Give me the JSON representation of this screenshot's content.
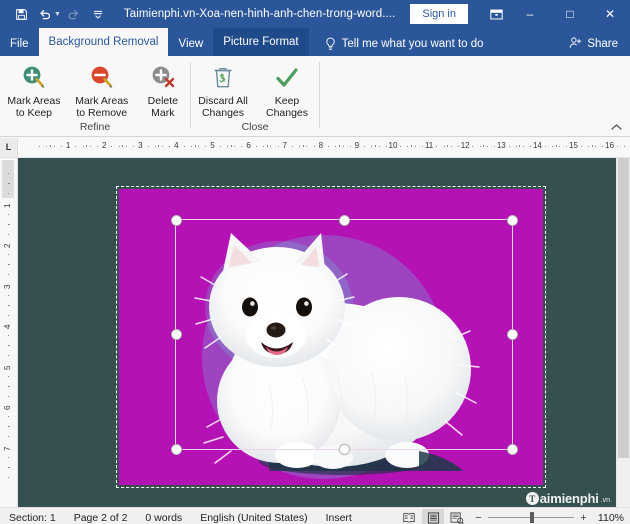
{
  "titlebar": {
    "quick_access": [
      {
        "name": "save-icon",
        "label": "Save"
      },
      {
        "name": "undo-icon",
        "label": "Undo"
      },
      {
        "name": "redo-icon",
        "label": "Redo"
      },
      {
        "name": "customize-qat-icon",
        "label": "Customize Quick Access Toolbar"
      }
    ],
    "document_title": "Taimienphi.vn-Xoa-nen-hinh-anh-chen-trong-word....",
    "sign_in": "Sign in",
    "ribbon_display_options": "Ribbon Display Options",
    "minimize": "–",
    "maximize": "□",
    "close": "✕",
    "bg_color": "#2b579a"
  },
  "tabs": [
    {
      "label": "File",
      "state": "normal"
    },
    {
      "label": "Background Removal",
      "state": "active"
    },
    {
      "label": "View",
      "state": "normal"
    },
    {
      "label": "Picture Format",
      "state": "contextual"
    }
  ],
  "tellme": {
    "icon": "lightbulb-icon",
    "label": "Tell me what you want to do"
  },
  "share": {
    "icon": "share-person-icon",
    "label": "Share"
  },
  "ribbon": {
    "collapse_icon": "chevron-up-icon",
    "groups": [
      {
        "label": "Refine",
        "buttons": [
          {
            "label_line1": "Mark Areas",
            "label_line2": "to Keep",
            "icon": "mark-areas-to-keep-icon",
            "color": "#3a8a74"
          },
          {
            "label_line1": "Mark Areas",
            "label_line2": "to Remove",
            "icon": "mark-areas-to-remove-icon",
            "color": "#d9482b"
          },
          {
            "label_line1": "Delete",
            "label_line2": "Mark",
            "icon": "delete-mark-icon",
            "color": "#8c8c8c"
          }
        ]
      },
      {
        "label": "Close",
        "buttons": [
          {
            "label_line1": "Discard All",
            "label_line2": "Changes",
            "icon": "trash-icon",
            "color": "#6e8d9c"
          },
          {
            "label_line1": "Keep",
            "label_line2": "Changes",
            "icon": "checkmark-icon",
            "color": "#4a9f5e"
          }
        ]
      }
    ]
  },
  "ruler": {
    "tab_selector": "L",
    "horizontal_numbers": [
      1,
      2,
      3,
      4,
      5,
      6,
      7,
      8,
      9,
      10,
      11,
      12,
      13,
      14,
      15,
      16
    ],
    "vertical_numbers": [
      1,
      2,
      3,
      4,
      5,
      6,
      7
    ]
  },
  "canvas": {
    "background_color": "#36504f",
    "removal_overlay_color": "#b512b5",
    "image_alt": "white pomeranian puppy photo with background removal magenta overlay",
    "selection_handles": 8,
    "watermark": {
      "badge": "T",
      "main": "aimienphi",
      "sub": ".vn"
    }
  },
  "statusbar": {
    "section": "Section: 1",
    "page": "Page 2 of 2",
    "words": "0 words",
    "language": "English (United States)",
    "mode": "Insert",
    "views": [
      {
        "name": "read-mode-icon",
        "label": "Read Mode",
        "active": false
      },
      {
        "name": "print-layout-icon",
        "label": "Print Layout",
        "active": true
      },
      {
        "name": "web-layout-icon",
        "label": "Web Layout",
        "active": false
      }
    ],
    "zoom_out": "−",
    "zoom_in": "+",
    "zoom_value": "110%"
  }
}
